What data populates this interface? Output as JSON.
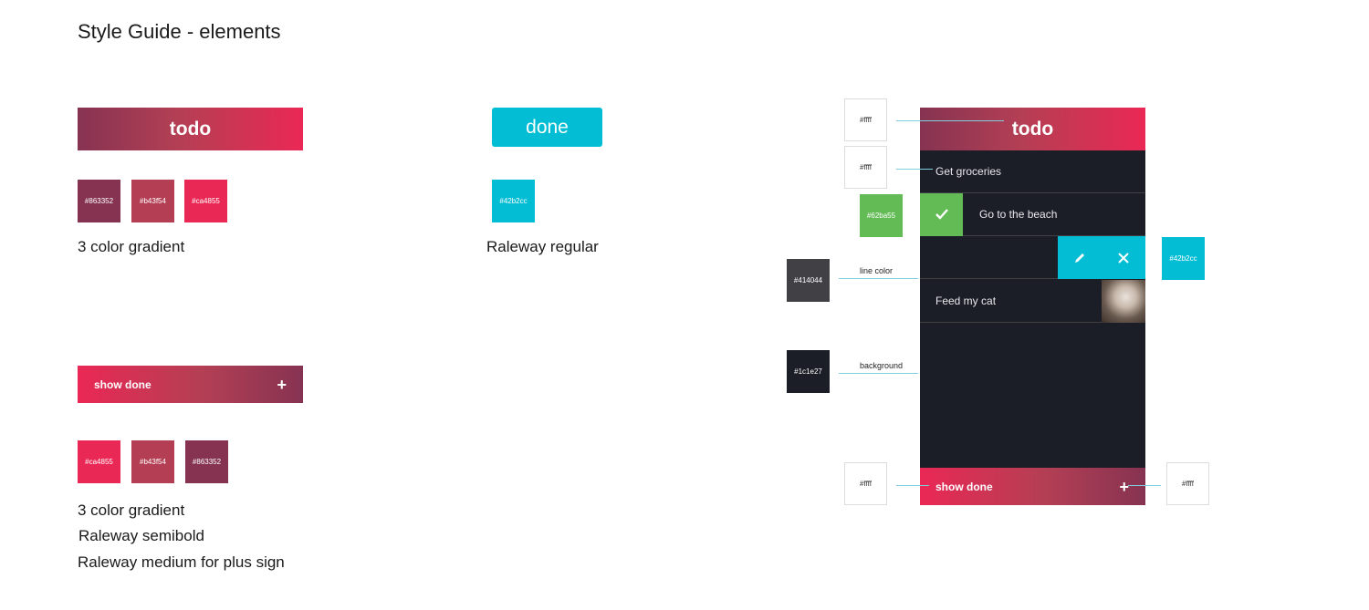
{
  "title": "Style Guide - elements",
  "todo_section": {
    "banner_label": "todo",
    "swatches": [
      {
        "label": "#863352",
        "color": "#863352"
      },
      {
        "label": "#b43f54",
        "color": "#b43f54"
      },
      {
        "label": "#ca4855",
        "color": "#ea2855"
      }
    ],
    "caption": "3 color gradient"
  },
  "done_section": {
    "button_label": "done",
    "swatch": {
      "label": "#42b2cc",
      "color": "#02bdd4"
    },
    "caption": "Raleway regular"
  },
  "show_done_section": {
    "bar_label": "show done",
    "plus": "+",
    "swatches": [
      {
        "label": "#ca4855",
        "color": "#ea2855"
      },
      {
        "label": "#b43f54",
        "color": "#b43f54"
      },
      {
        "label": "#863352",
        "color": "#863352"
      }
    ],
    "captions": [
      "3 color gradient",
      "Raleway semibold",
      "Raleway medium for plus sign"
    ]
  },
  "phone": {
    "header": "todo",
    "rows": [
      "Get groceries",
      "Go to the beach",
      "Feed my cat"
    ],
    "footer_label": "show done",
    "footer_plus": "+",
    "icons": [
      "check-icon",
      "pencil-icon",
      "close-icon"
    ]
  },
  "annotations": {
    "white_labels": [
      "#ffff",
      "#ffff",
      "#ffff",
      "#ffff"
    ],
    "green": {
      "label": "#62ba55",
      "color": "#62bb55"
    },
    "cyan": {
      "label": "#42b2cc",
      "color": "#02bdd4"
    },
    "line_color": {
      "label": "#414044",
      "color": "#414044",
      "caption": "line color"
    },
    "background": {
      "label": "#1c1e27",
      "color": "#1c1e27",
      "caption": "background"
    }
  }
}
